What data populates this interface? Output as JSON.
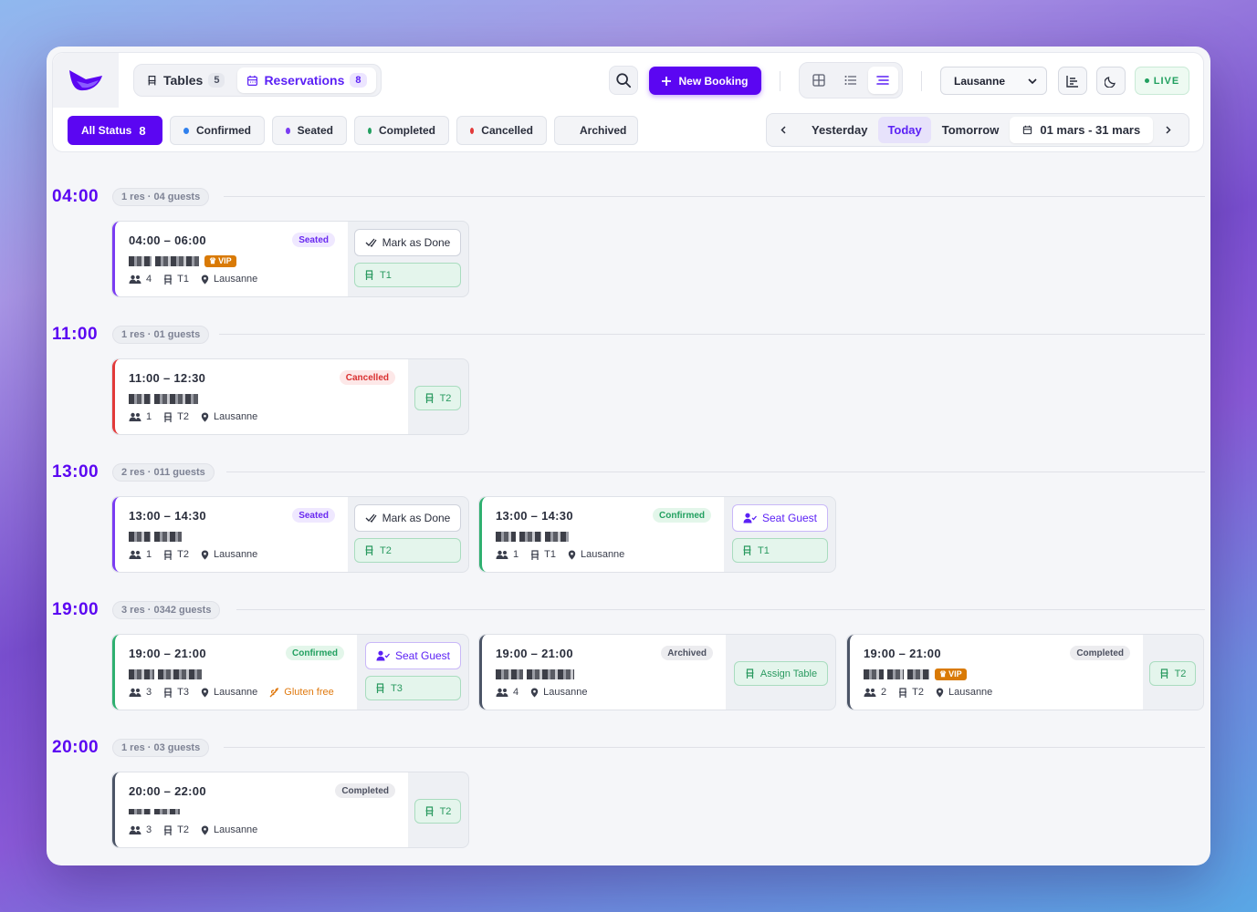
{
  "header": {
    "tabs": [
      {
        "label": "Tables",
        "count": "5"
      },
      {
        "label": "Reservations",
        "count": "8"
      }
    ],
    "new_booking": "New Booking",
    "location": "Lausanne",
    "live": "LIVE"
  },
  "filters": {
    "all": {
      "label": "All Status",
      "count": "8"
    },
    "items": [
      {
        "label": "Confirmed",
        "color": "#2f80ed"
      },
      {
        "label": "Seated",
        "color": "#7a3cf2"
      },
      {
        "label": "Completed",
        "color": "#22a060"
      },
      {
        "label": "Cancelled",
        "color": "#e23a3a"
      },
      {
        "label": "Archived"
      }
    ]
  },
  "datenav": {
    "yesterday": "Yesterday",
    "today": "Today",
    "tomorrow": "Tomorrow",
    "range": "01 mars - 31 mars"
  },
  "colors": {
    "accent": "#5b06f2",
    "seated": "#7a3cf2",
    "cancelled": "#e23a3a",
    "confirmed": "#2fb070",
    "archived": "#4c5567"
  },
  "slots": [
    {
      "time": "04:00",
      "summary": "1 res · 04 guests",
      "cards": [
        {
          "time": "04:00 – 06:00",
          "status": "Seated",
          "vip": "VIP",
          "guests": "4",
          "table": "T1",
          "location": "Lausanne",
          "action": "Mark as Done",
          "assigned": "T1"
        }
      ]
    },
    {
      "time": "11:00",
      "summary": "1 res · 01 guests",
      "cards": [
        {
          "time": "11:00 – 12:30",
          "status": "Cancelled",
          "guests": "1",
          "table": "T2",
          "location": "Lausanne",
          "assigned": "T2"
        }
      ]
    },
    {
      "time": "13:00",
      "summary": "2 res · 011 guests",
      "cards": [
        {
          "time": "13:00 – 14:30",
          "status": "Seated",
          "guests": "1",
          "table": "T2",
          "location": "Lausanne",
          "action": "Mark as Done",
          "assigned": "T2"
        },
        {
          "time": "13:00 – 14:30",
          "status": "Confirmed",
          "guests": "1",
          "table": "T1",
          "location": "Lausanne",
          "action": "Seat Guest",
          "assigned": "T1"
        }
      ]
    },
    {
      "time": "19:00",
      "summary": "3 res · 0342 guests",
      "cards": [
        {
          "time": "19:00 – 21:00",
          "status": "Confirmed",
          "guests": "3",
          "table": "T3",
          "location": "Lausanne",
          "diet": "Gluten free",
          "action": "Seat Guest",
          "assigned": "T3"
        },
        {
          "time": "19:00 – 21:00",
          "status": "Archived",
          "guests": "4",
          "location": "Lausanne",
          "action": "Assign Table"
        },
        {
          "time": "19:00 – 21:00",
          "status": "Completed",
          "vip": "VIP",
          "guests": "2",
          "table": "T2",
          "location": "Lausanne",
          "assigned": "T2"
        }
      ]
    },
    {
      "time": "20:00",
      "summary": "1 res · 03 guests",
      "cards": [
        {
          "time": "20:00 – 22:00",
          "status": "Completed",
          "guests": "3",
          "table": "T2",
          "location": "Lausanne",
          "assigned": "T2"
        }
      ]
    }
  ]
}
